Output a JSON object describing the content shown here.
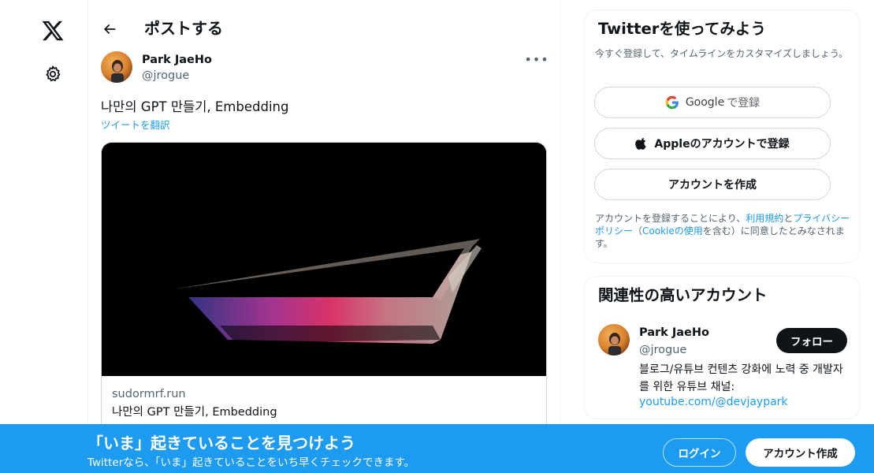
{
  "nav": {
    "logo_icon": "x-logo-icon",
    "settings_icon": "gear-icon"
  },
  "header": {
    "back_icon": "arrow-left-icon",
    "title": "ポストする"
  },
  "post": {
    "author_name": "Park JaeHo",
    "author_handle": "@jrogue",
    "more_label": "•••",
    "text": "나만의 GPT 만들기, Embedding",
    "translate_label": "ツイートを翻訳",
    "card": {
      "domain": "sudormrf.run",
      "title": "나만의 GPT 만들기, Embedding"
    }
  },
  "signup": {
    "title": "Twitterを使ってみよう",
    "description": "今すぐ登録して、タイムラインをカスタマイズしましょう。",
    "google_label": "Google",
    "google_suffix": "で登録",
    "apple_label": "Appleのアカウントで登録",
    "create_label": "アカウントを作成",
    "terms_prefix": "アカウントを登録することにより、",
    "terms_link": "利用規約",
    "terms_and": "と",
    "privacy_link": "プライバシーポリシー",
    "terms_paren_open": "（",
    "cookie_link": "Cookieの使用",
    "terms_suffix": "を含む）に同意したとみなされます。"
  },
  "related": {
    "title": "関連性の高いアカウント",
    "name": "Park JaeHo",
    "handle": "@jrogue",
    "follow_label": "フォロー",
    "bio": "블로그/유튜브 컨텐츠 강화에 노력 중 개발자를 위한 유튜브 채널:",
    "link": "youtube.com/@devjaypark"
  },
  "banner": {
    "title": "「いま」起きていることを見つけよう",
    "subtitle": "Twitterなら、「いま」起きていることをいち早くチェックできます。",
    "login_label": "ログイン",
    "create_label": "アカウント作成"
  },
  "colors": {
    "accent": "#1d9bf0",
    "text": "#0f1419",
    "muted": "#536471",
    "border": "#cfd9de"
  }
}
